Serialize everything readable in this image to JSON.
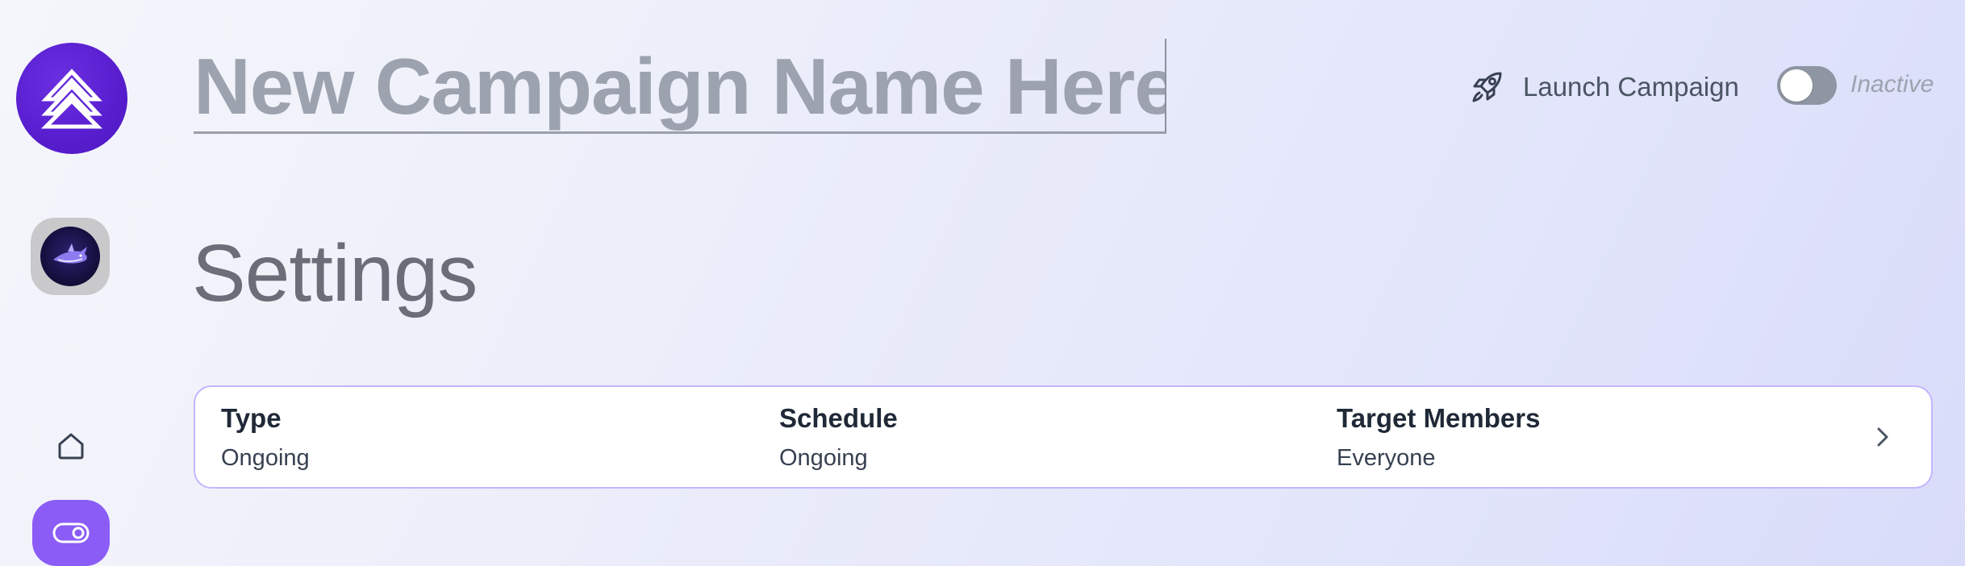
{
  "sidebar": {
    "logo_icon": "stacked-chevrons-logo",
    "avatar_icon": "shark-avatar",
    "home_icon": "home-icon",
    "campaigns_icon": "toggle-icon",
    "accent_color": "#8b5cf6"
  },
  "header": {
    "campaign_name": "New Campaign Name Here",
    "launch_label": "Launch Campaign",
    "launch_icon": "rocket-icon",
    "status_label": "Inactive",
    "status_active": false
  },
  "settings": {
    "heading": "Settings",
    "columns": [
      {
        "title": "Type",
        "value": "Ongoing"
      },
      {
        "title": "Schedule",
        "value": "Ongoing"
      },
      {
        "title": "Target Members",
        "value": "Everyone"
      }
    ]
  }
}
